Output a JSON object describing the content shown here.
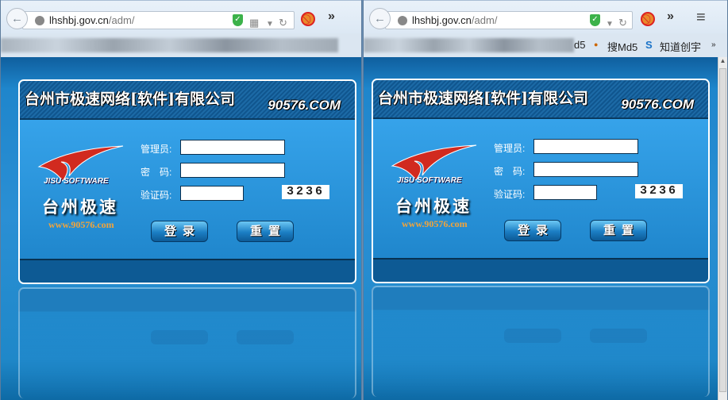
{
  "browser": {
    "url_host": "lhshbj.gov.cn",
    "url_path": "/adm/",
    "bookmarks": [
      "d5",
      "搜Md5",
      "知道创宇"
    ],
    "overflow": "»"
  },
  "login": {
    "company": "台州市极速网络[软件]有限公司",
    "domain": "90576.COM",
    "brand_en": "JISU SOFTWARE",
    "brand_cn": "台州极速",
    "website": "www.90576.com",
    "labels": {
      "admin": "管理员:",
      "password": "密　码:",
      "captcha": "验证码:"
    },
    "fields": {
      "admin": "",
      "password": "",
      "captcha": ""
    },
    "captcha_code": "3236",
    "login_button": "登录",
    "reset_button": "重置"
  }
}
